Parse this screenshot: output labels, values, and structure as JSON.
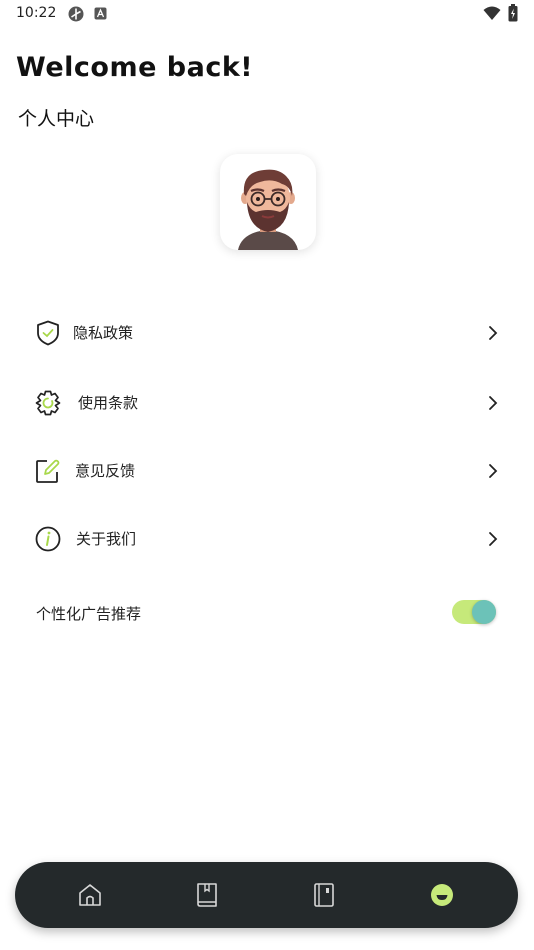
{
  "status_bar": {
    "time": "10:22",
    "left_icons": [
      "sync-icon",
      "app-notification-icon"
    ],
    "right_icons": [
      "wifi-icon",
      "battery-icon"
    ]
  },
  "header": {
    "welcome": "Welcome back!",
    "subtitle": "个人中心"
  },
  "menu": {
    "items": [
      {
        "label": "隐私政策",
        "icon": "shield-check-icon"
      },
      {
        "label": "使用条款",
        "icon": "gear-icon"
      },
      {
        "label": "意见反馈",
        "icon": "edit-note-icon"
      },
      {
        "label": "关于我们",
        "icon": "info-icon"
      }
    ]
  },
  "ad_setting": {
    "label": "个性化广告推荐",
    "enabled": true
  },
  "bottom_nav": {
    "items": [
      "home-icon",
      "book-icon",
      "notebook-icon",
      "profile-icon"
    ],
    "active_index": 3
  },
  "colors": {
    "accent": "#c6e97a",
    "knob": "#6cc2b8",
    "nav_bg": "#24292b"
  }
}
